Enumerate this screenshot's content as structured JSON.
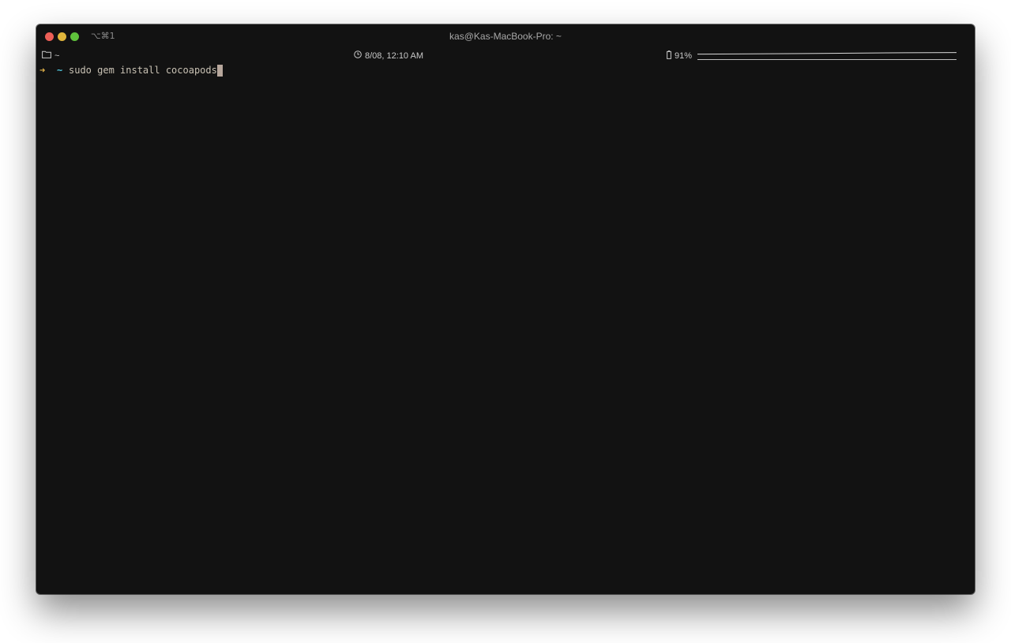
{
  "window": {
    "title": "kas@Kas-MacBook-Pro: ~",
    "shortcut": "⌥⌘1",
    "traffic_lights": {
      "close": "#ec5f57",
      "minimize": "#e0b53b",
      "zoom": "#5fc23c"
    }
  },
  "statusbar": {
    "directory": "~",
    "datetime": "8/08, 12:10 AM",
    "battery": "91%",
    "folder_icon": "folder-icon",
    "clock_icon": "clock-icon",
    "battery_icon": "battery-icon"
  },
  "terminal": {
    "prompt_arrow": "➜",
    "prompt_dir": "~",
    "command": "sudo gem install cocoapods"
  },
  "colors": {
    "background": "#121212",
    "prompt_arrow": "#e2b34a",
    "prompt_dir": "#4ec1d6",
    "command_text": "#c9c2b4",
    "cursor": "#b7a79c"
  }
}
